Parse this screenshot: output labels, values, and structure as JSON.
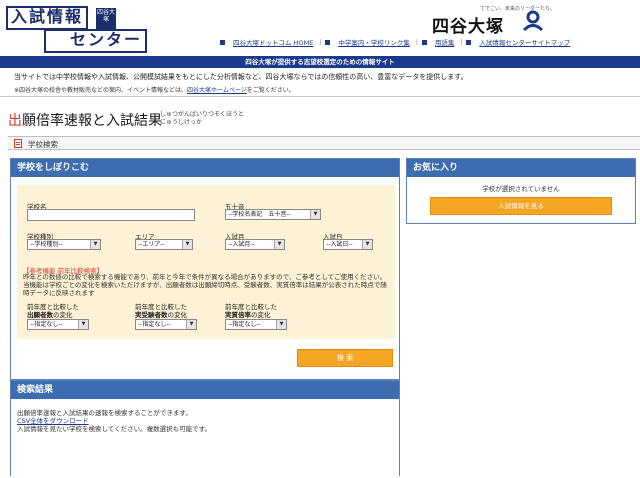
{
  "header": {
    "logo": {
      "line1": "入試情報",
      "line2": "センター",
      "side": "四谷大塚"
    },
    "brand": {
      "tagline": "てでこい、未来のリーダーたち。",
      "name": "四谷大塚"
    },
    "nav": [
      "四谷大塚ドットコム HOME",
      "中学案内・学校リンク集",
      "用語集",
      "入試情報センターサイトマップ"
    ]
  },
  "banner": "四谷大塚が提供する志望校選定のための情報サイト",
  "intro": {
    "main": "当サイトでは中学校情報や入試情報、公開模試結果をもとにした分析情報など、四谷大塚ならではの信頼性の高い、豊富なデータを提供します。",
    "sub_prefix": "※四谷大塚の校舎や教材販売などの案内、イベント情報などは、",
    "sub_link": "四谷大塚ホームページ",
    "sub_suffix": "をご覧ください。"
  },
  "page": {
    "title_first": "出",
    "title_rest": "願倍率速報と入試結果",
    "ruby_line1": "しゅつがんばいりつそくほうと",
    "ruby_line2": "にゅうしけっか"
  },
  "section_tab": "学校検索",
  "search_panel": {
    "title": "学校をしぼりこむ",
    "school_name_label": "学校名",
    "school_name_value": "",
    "gojuon_label": "五十音",
    "gojuon_value": "--学校名表記　五十音--",
    "type_label": "学校種別",
    "type_value": "--学校種別--",
    "area_label": "エリア",
    "area_value": "--エリア--",
    "month_label": "入試月",
    "month_value": "--入試月--",
    "day_label": "入試日",
    "day_value": "--入試日--",
    "note_red": "【参考機能 前年比較検索】",
    "note_text": "昨年との数値の比較で検索する機能であり、前年と今年で条件が異なる場合がありますので、ご参考としてご使用ください。当機能は学校ごとの変化を検索いただけますが、出願者数は出願締切時点、受験者数、実質倍率は結果が公表された時点で随時データに反映されます",
    "cmp1_line1": "前年度と比較した",
    "cmp1_line2": "出願者数",
    "cmp1_line2b": "の変化",
    "cmp2_line1": "前年度と比較した",
    "cmp2_line2": "実受験者数",
    "cmp2_line2b": "の変化",
    "cmp3_line1": "前年度と比較した",
    "cmp3_line2": "実質倍率",
    "cmp3_line2b": "の変化",
    "cmp_value": "--指定なし--",
    "search_button": "検 索"
  },
  "fav_panel": {
    "title": "お気に入り",
    "empty_text": "学校が選択されていません",
    "button": "入試情報を見る"
  },
  "results_panel": {
    "title": "検索結果",
    "line1": "出願倍率速報と入試結果の速報を検索することができます。",
    "line2_link": "CSV全体をダウンロード",
    "line3": "入試情報を見たい学校を検索してください。複数選択も可能です。"
  },
  "colors": {
    "brand_navy": "#1b2d6b",
    "panel_blue": "#3d6db0",
    "accent_orange": "#f5a623",
    "form_bg": "#fdf2d5",
    "title_red": "#d43a2a"
  }
}
